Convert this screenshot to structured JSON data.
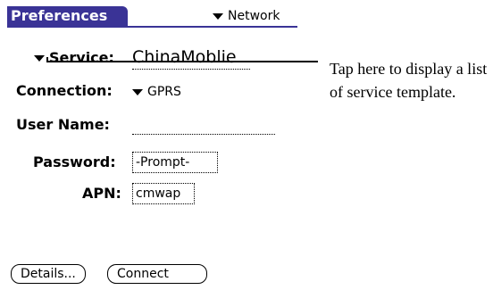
{
  "header": {
    "title": "Preferences",
    "category": "Network"
  },
  "form": {
    "service_label": "Service:",
    "service_value": "ChinaMoblie",
    "connection_label": "Connection:",
    "connection_value": "GPRS",
    "username_label": "User Name:",
    "username_value": "",
    "password_label": "Password:",
    "password_value": "-Prompt-",
    "apn_label": "APN:",
    "apn_value": "cmwap"
  },
  "buttons": {
    "details": "Details...",
    "connect": "Connect"
  },
  "callout": "Tap here to display a list of service template."
}
